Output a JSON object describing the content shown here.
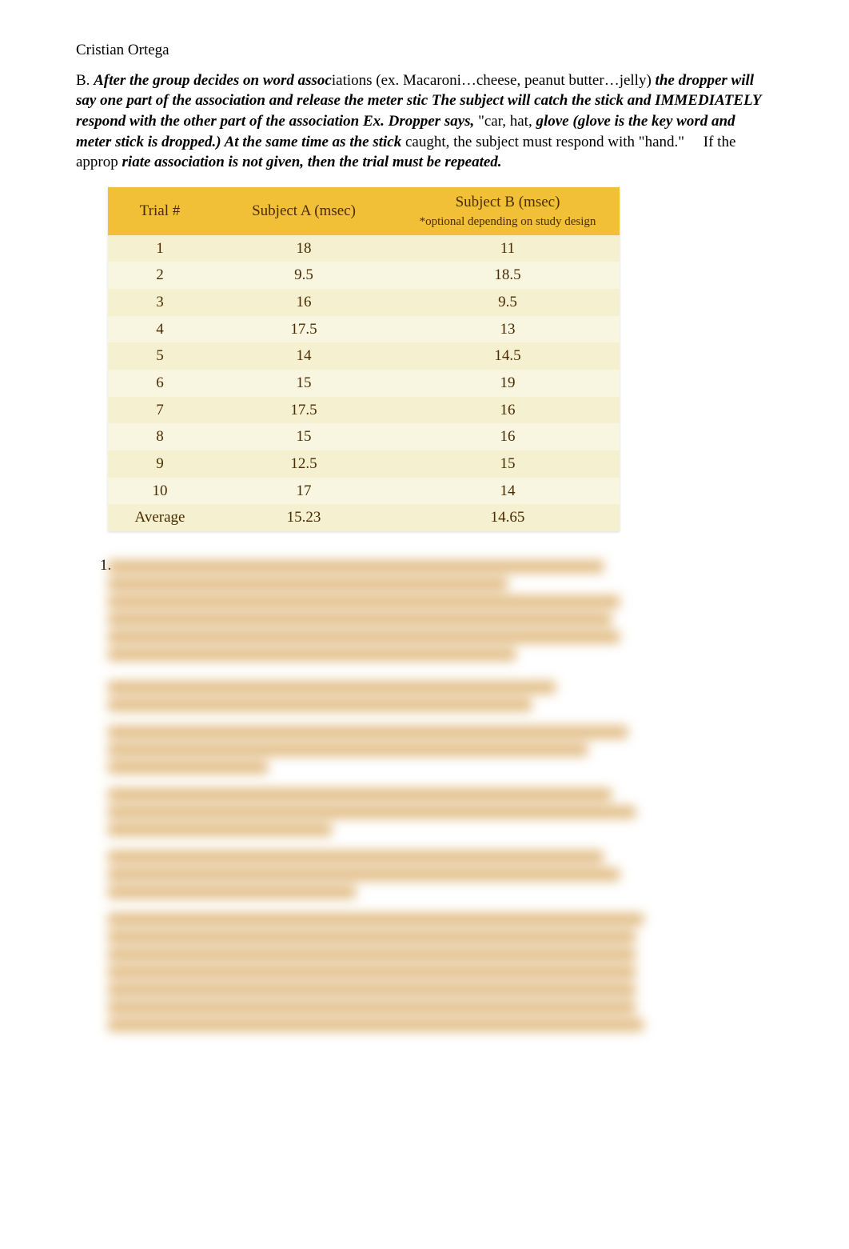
{
  "author": "Cristian Ortega",
  "section_label": "B.",
  "instruction_parts": {
    "p1": "After the group decides on word a",
    "p2": "ssoc",
    "p3": "iations",
    "p4": "(ex. Macaroni…cheese, peanut butter…jelly)",
    "p5": "the dropper will say one part of the association and release the me",
    "p6": "ter stic",
    "p7": "The subject will catch",
    "p8": "the stick and IMMEDIATELY respond with the other part of the assoc",
    "p9": "iation",
    "p10": "Ex. D",
    "p11": "ropper says,",
    "p12": "\"car, hat,",
    "p13": "glove (glove is the key word and meter stick is dropped.) At the same time as the stick",
    "p14": "caught, the subject must respond with \"hand.\"",
    "p15": "If the approp",
    "p16": "riate association is not given, then",
    "p17": "the trial must be repeated."
  },
  "table": {
    "headers": {
      "trial": "Trial #",
      "subjectA": "Subject A (msec)",
      "subjectB": "Subject B (msec)",
      "subjectB_note": "*optional depending on study design"
    },
    "rows": [
      {
        "trial": "1",
        "a": "18",
        "b": "11"
      },
      {
        "trial": "2",
        "a": "9.5",
        "b": "18.5"
      },
      {
        "trial": "3",
        "a": "16",
        "b": "9.5"
      },
      {
        "trial": "4",
        "a": "17.5",
        "b": "13"
      },
      {
        "trial": "5",
        "a": "14",
        "b": "14.5"
      },
      {
        "trial": "6",
        "a": "15",
        "b": "19"
      },
      {
        "trial": "7",
        "a": "17.5",
        "b": "16"
      },
      {
        "trial": "8",
        "a": "15",
        "b": "16"
      },
      {
        "trial": "9",
        "a": "12.5",
        "b": "15"
      },
      {
        "trial": "10",
        "a": "17",
        "b": "14"
      },
      {
        "trial": "Average",
        "a": "15.23",
        "b": "14.65"
      }
    ]
  },
  "question_number": "1.",
  "blurred_paragraphs": [
    {
      "lines": [
        620,
        500,
        640,
        630,
        640,
        510
      ]
    },
    {
      "lines": [
        560,
        530
      ]
    },
    {
      "lines": [
        650,
        600,
        200
      ]
    },
    {
      "lines": [
        630,
        660,
        280
      ]
    },
    {
      "lines": [
        620,
        640,
        310
      ]
    },
    {
      "lines": [
        670,
        660,
        660,
        660,
        660,
        660,
        670
      ]
    }
  ]
}
